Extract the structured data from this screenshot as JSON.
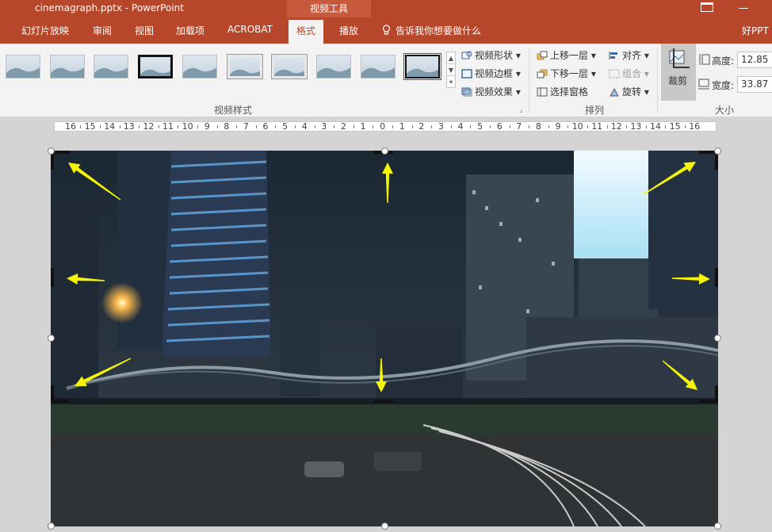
{
  "titlebar": {
    "document_title": "cinemagraph.pptx - PowerPoint",
    "contextual_tab": "视频工具"
  },
  "tabs": [
    "幻灯片放映",
    "审阅",
    "视图",
    "加载项",
    "ACROBAT",
    "格式",
    "播放"
  ],
  "active_tab": "格式",
  "tell_me": "告诉我你想要做什么",
  "user_name": "好PPT",
  "ribbon": {
    "video_styles": {
      "group_label": "视频样式",
      "commands": {
        "shape": "视频形状",
        "border": "视频边框",
        "effects": "视频效果"
      }
    },
    "arrange": {
      "group_label": "排列",
      "bring_forward": "上移一层",
      "send_backward": "下移一层",
      "selection_pane": "选择窗格",
      "align": "对齐",
      "group": "组合",
      "rotate": "旋转"
    },
    "size": {
      "group_label": "大小",
      "crop": "裁剪",
      "height_label": "高度:",
      "height_value": "12.85",
      "width_label": "宽度:",
      "width_value": "33.87"
    }
  },
  "ruler_labels": [
    "16",
    "15",
    "14",
    "13",
    "12",
    "11",
    "10",
    "9",
    "8",
    "7",
    "6",
    "5",
    "4",
    "3",
    "2",
    "1",
    "0",
    "1",
    "2",
    "3",
    "4",
    "5",
    "6",
    "7",
    "8",
    "9",
    "10",
    "11",
    "12",
    "13",
    "14",
    "15",
    "16"
  ],
  "colors": {
    "accent": "#b7472a",
    "contextual_tab": "#c75a3d",
    "arrow": "#f5f50a"
  }
}
